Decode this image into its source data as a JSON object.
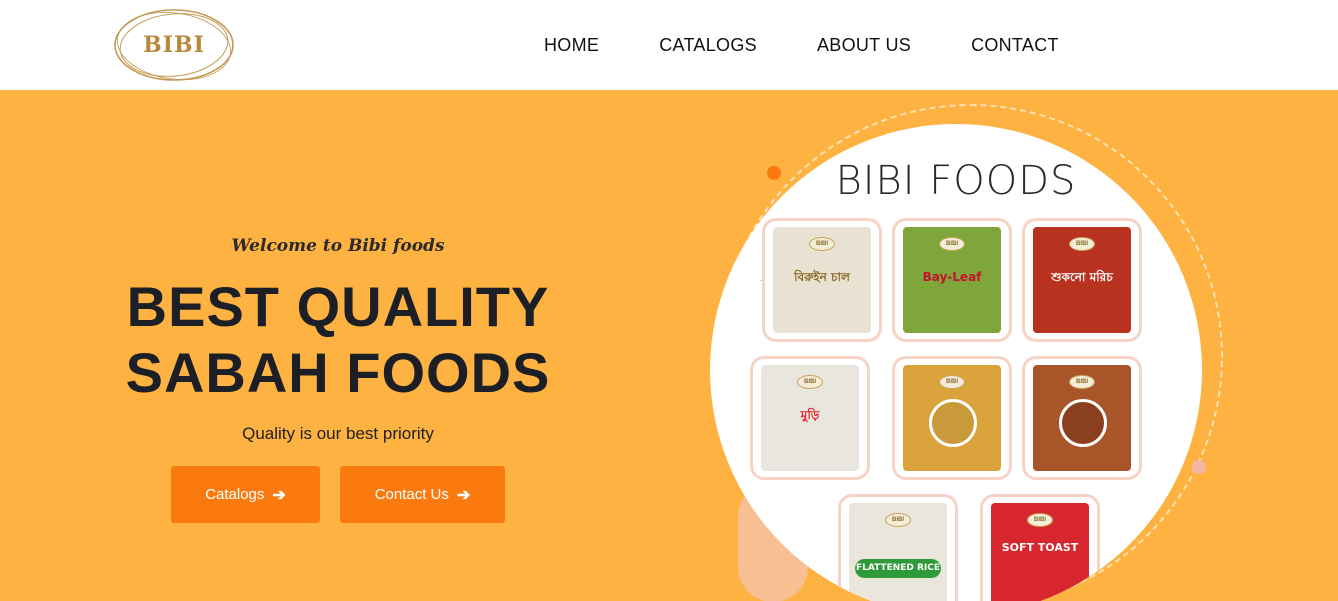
{
  "header": {
    "logo_text": "BIBI",
    "nav": [
      {
        "label": "HOME"
      },
      {
        "label": "CATALOGS"
      },
      {
        "label": "ABOUT US"
      },
      {
        "label": "CONTACT"
      }
    ]
  },
  "hero": {
    "welcome": "Welcome to Bibi foods",
    "headline_line1": "BEST QUALITY",
    "headline_line2": "SABAH FOODS",
    "tagline": "Quality is our best priority",
    "buttons": {
      "catalogs": "Catalogs",
      "contact": "Contact Us",
      "arrow_icon": "arrow-right-icon"
    },
    "image_title": "BIBI FOODS",
    "products": [
      {
        "label": "বিরুইন চাল",
        "bag_color": "#e9e2d2",
        "text_color": "#8a6a2a"
      },
      {
        "label": "Bay-Leaf",
        "bag_color": "#7fa63a",
        "text_color": "#c4122f"
      },
      {
        "label": "শুকনো মরিচ",
        "bag_color": "#b8321f",
        "text_color": "#ffffff"
      },
      {
        "label": "মুড়ি",
        "bag_color": "#e8e6df",
        "text_color": "#e4222a"
      },
      {
        "label": "",
        "bag_color": "#d9a23a",
        "text_color": "#ffffff"
      },
      {
        "label": "",
        "bag_color": "#a8552a",
        "text_color": "#ffffff"
      },
      {
        "label": "FLATTENED RICE",
        "bag_color": "#eae6dc",
        "text_color": "#ffffff"
      },
      {
        "label": "SOFT TOAST",
        "bag_color": "#d8262e",
        "text_color": "#ffffff"
      }
    ]
  },
  "colors": {
    "hero_bg": "#fdb241",
    "button_bg": "#fb7a0f",
    "logo_gold": "#b8893a"
  }
}
